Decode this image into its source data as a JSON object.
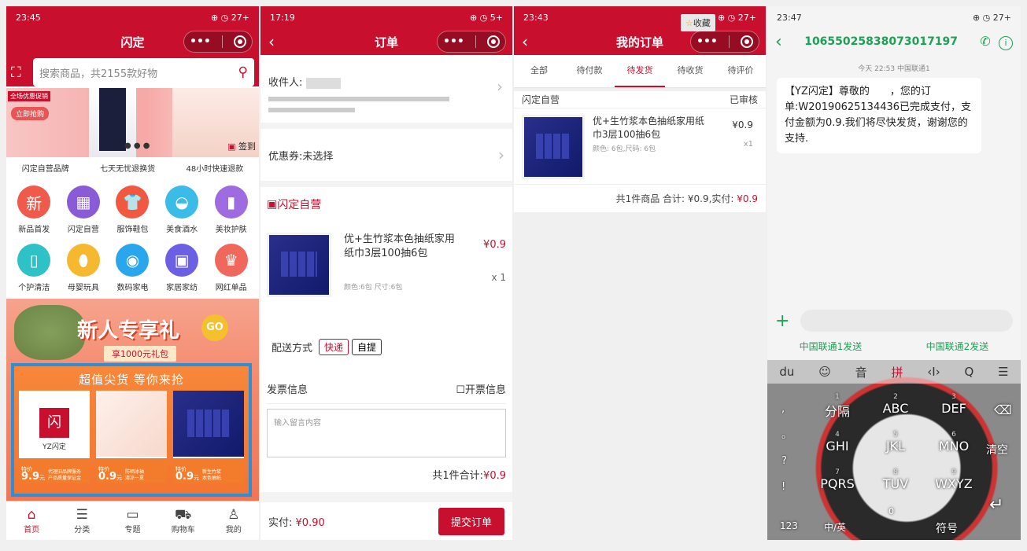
{
  "watermark_text": "",
  "p1": {
    "status": "23:45",
    "status_right": "27",
    "title": "闪定",
    "search_placeholder": "搜索商品，共2155款好物",
    "banner": {
      "tag": "全场优惠促销",
      "btn": "立即抢购",
      "signin": "签到"
    },
    "trust": [
      "闪定自营品牌",
      "七天无忧退换货",
      "48小时快速退款"
    ],
    "icons": [
      {
        "label": "新品首发",
        "glyph": "新",
        "color": "#f05a4a"
      },
      {
        "label": "闪定自营",
        "glyph": "▦",
        "color": "#8a5bd6"
      },
      {
        "label": "服饰鞋包",
        "glyph": "👕",
        "color": "#f2573f"
      },
      {
        "label": "美食酒水",
        "glyph": "◒",
        "color": "#3bbbe8"
      },
      {
        "label": "美妆护肤",
        "glyph": "▮",
        "color": "#9f6be0"
      },
      {
        "label": "个护清洁",
        "glyph": "▯",
        "color": "#2ec2c6"
      },
      {
        "label": "母婴玩具",
        "glyph": "⬮",
        "color": "#f5b82e"
      },
      {
        "label": "数码家电",
        "glyph": "◉",
        "color": "#2aa6ec"
      },
      {
        "label": "家居家纺",
        "glyph": "▣",
        "color": "#6b60e3"
      },
      {
        "label": "网红单品",
        "glyph": "♛",
        "color": "#f0685b"
      }
    ],
    "promo": {
      "title": "新人专享礼",
      "gift": "享1000元礼包",
      "go": "GO",
      "section": "超值尖货 等你来抢"
    },
    "deals": [
      {
        "logo": "YZ闪定",
        "price_label": "特价",
        "price": "9.9",
        "unit": "元",
        "note": "代理旧品牌服务",
        "note2": "产品质量保证金"
      },
      {
        "price_label": "特价",
        "price": "0.9",
        "unit": "元",
        "note": "防晒冰袖",
        "note2": "清凉一夏"
      },
      {
        "price_label": "特价",
        "price": "0.9",
        "unit": "元",
        "note": "新生竹浆",
        "note2": "本色抽纸"
      }
    ],
    "tabs": [
      "首页",
      "分类",
      "专题",
      "购物车",
      "我的"
    ]
  },
  "p2": {
    "status": "17:19",
    "status_right": "5",
    "title": "订单",
    "receiver_label": "收件人:",
    "coupon": "优惠券:未选择",
    "shop": "闪定自营",
    "product": "优+生竹浆本色抽纸家用纸巾3层100抽6包",
    "price": "¥0.9",
    "spec": "颜色:6包 尺寸:6包",
    "qty": "x 1",
    "ship_label": "配送方式",
    "ship_opts": [
      "快递",
      "自提"
    ],
    "invoice_label": "发票信息",
    "invoice_toggle": "开票信息",
    "note_placeholder": "输入留言内容",
    "total_label": "共1件合计:",
    "total": "¥0.9",
    "pay_label": "实付:",
    "pay": "¥0.90",
    "submit": "提交订单"
  },
  "p3": {
    "status": "23:43",
    "status_right": "27",
    "title": "我的订单",
    "fav": "收藏",
    "tabs": [
      "全部",
      "待付款",
      "待发货",
      "待收货",
      "待评价"
    ],
    "shop": "闪定自营",
    "state": "已审核",
    "product": "优+生竹浆本色抽纸家用纸巾3层100抽6包",
    "price": "¥0.9",
    "spec": "颜色: 6包,尺码: 6包",
    "qty": "x1",
    "summary": "共1件商品 合计: ¥0.9,实付:",
    "pay": "¥0.9"
  },
  "p4": {
    "status": "23:47",
    "status_right": "27",
    "number": "10655025838073017197",
    "time": "今天 22:53 中国联通1",
    "msg": "【YZ闪定】尊敬的　　，您的订单:W20190625134436已完成支付，支付金额为0.9.我们将尽快发货，谢谢您的支持.",
    "send1": "中国联通1发送",
    "send2": "中国联通2发送",
    "kb_top": [
      "du",
      "☺",
      "音",
      "拼",
      "‹I›",
      "Q",
      "☰"
    ],
    "keys": [
      {
        "num": "1",
        "l": "分隔"
      },
      {
        "num": "2",
        "l": "ABC"
      },
      {
        "num": "3",
        "l": "DEF"
      },
      {
        "num": "4",
        "l": "GHI"
      },
      {
        "num": "5",
        "l": "JKL"
      },
      {
        "num": "6",
        "l": "MNO"
      },
      {
        "num": "7",
        "l": "PQRS"
      },
      {
        "num": "8",
        "l": "TUV"
      },
      {
        "num": "9",
        "l": "WXYZ"
      }
    ],
    "left_keys": [
      ",",
      "。",
      "?",
      "!"
    ],
    "clear": "清空",
    "k123": "123",
    "zh": "中/英",
    "sym": "符号",
    "zero": "0"
  }
}
